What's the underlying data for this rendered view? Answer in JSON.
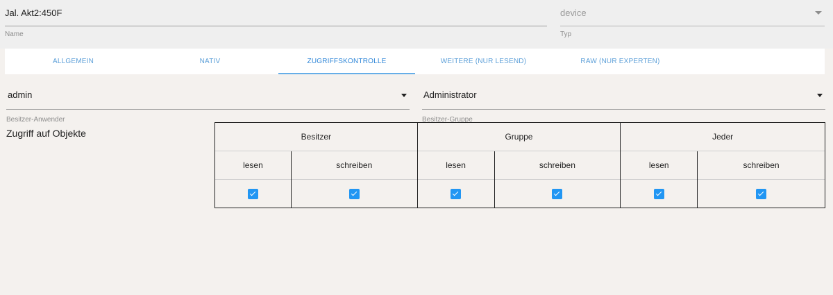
{
  "name_field": {
    "value": "Jal. Akt2:450F",
    "label": "Name"
  },
  "typ_field": {
    "value": "device",
    "label": "Typ"
  },
  "tabs": [
    {
      "label": "ALLGEMEIN"
    },
    {
      "label": "NATIV"
    },
    {
      "label": "ZUGRIFFSKONTROLLE"
    },
    {
      "label": "WEITERE (NUR LESEND)"
    },
    {
      "label": "RAW (NUR EXPERTEN)"
    }
  ],
  "active_tab": "ZUGRIFFSKONTROLLE",
  "owner_user": {
    "value": "admin",
    "label": "Besitzer-Anwender"
  },
  "owner_group": {
    "value": "Administrator",
    "label": "Besitzer-Gruppe"
  },
  "section_title": "Zugriff auf Objekte",
  "acl": {
    "groups": [
      {
        "name": "Besitzer",
        "read_label": "lesen",
        "write_label": "schreiben",
        "read": true,
        "write": true
      },
      {
        "name": "Gruppe",
        "read_label": "lesen",
        "write_label": "schreiben",
        "read": true,
        "write": true
      },
      {
        "name": "Jeder",
        "read_label": "lesen",
        "write_label": "schreiben",
        "read": true,
        "write": true
      }
    ]
  },
  "colors": {
    "accent": "#2196f3",
    "tab_text": "#5c9fd8",
    "background": "#f4f1ee"
  }
}
